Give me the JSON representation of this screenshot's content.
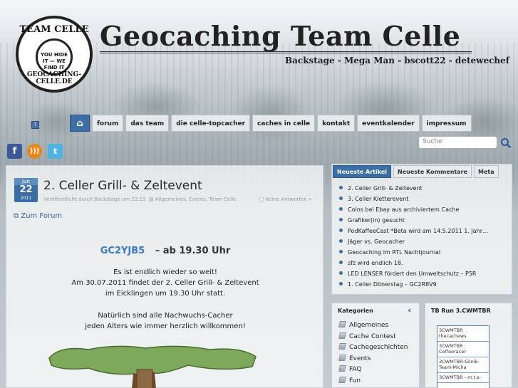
{
  "header": {
    "logo_top": "TEAM CELLE",
    "logo_inner": "YOU HIDE IT — WE FIND IT",
    "logo_bottom": "GEOCACHING-CELLE.DE",
    "site_title": "Geocaching Team Celle",
    "tagline": "Backstage - Mega Man - bscott22 - detewechef"
  },
  "nav": {
    "home_icon": "home-icon",
    "items": [
      "forum",
      "das team",
      "die celle-topcacher",
      "caches in celle",
      "kontakt",
      "eventkalender",
      "impressum"
    ]
  },
  "search": {
    "placeholder": "Suche"
  },
  "social": {
    "facebook": "f",
    "rss": "rss",
    "twitter": "t"
  },
  "post": {
    "date_month": "Jun",
    "date_day": "22",
    "date_year": "2011",
    "title": "2. Celler Grill- & Zeltevent",
    "meta": "Veröffentlicht durch Backstage um 22:15",
    "categories": "Allgemeines, Events, Team Celle",
    "comments": "Keine Antworten »",
    "forum_link": "Zum Forum",
    "gc_code": "GC2YJB5",
    "gc_time": "– ab 19.30 Uhr",
    "paragraph1": [
      "Es ist endlich wieder so weit!",
      "Am 30.07.2011 findet der 2. Celler Grill- & Zeltevent",
      "im Eicklingen um 19.30 Uhr statt."
    ],
    "paragraph2": [
      "Natürlich sind alle Nachwuchs-Cacher",
      "jeden Alters wie immer herzlich willkommen!"
    ]
  },
  "tabs_widget": {
    "tabs": [
      "Neueste Artikel",
      "Neueste Kommentare",
      "Meta"
    ],
    "articles": [
      "2. Celler Grill- & Zeltevent",
      "3. Celler Kletterevent",
      "Coins bei Ebay aus archiviertem Cache",
      "Grafiker(in) gesucht",
      "PodKaffeeCast *Beta wird am 14.5.2011 1. Jahr…",
      "Jäger vs. Geocacher",
      "Geocaching im RTL Nachtjournal",
      "sfz wird endlich 18.",
      "LED LENSER fördert den Umweltschutz – P5R",
      "1. Celler Dönerstag – GC2R8V9"
    ]
  },
  "categories_widget": {
    "title": "Kategorien",
    "items": [
      "Allgemeines",
      "Cache Contest",
      "Cachegeschichten",
      "Events",
      "FAQ",
      "Fun"
    ]
  },
  "tb_widget": {
    "title": "TB Run 3.CWMTBR",
    "items": [
      "3CWMTBR thecachews",
      "3CWMTBR Coffeeracer",
      "3CWMTBR-Gilnik-Team-Micha",
      "3CWMTBR - m.t.s-"
    ]
  }
}
